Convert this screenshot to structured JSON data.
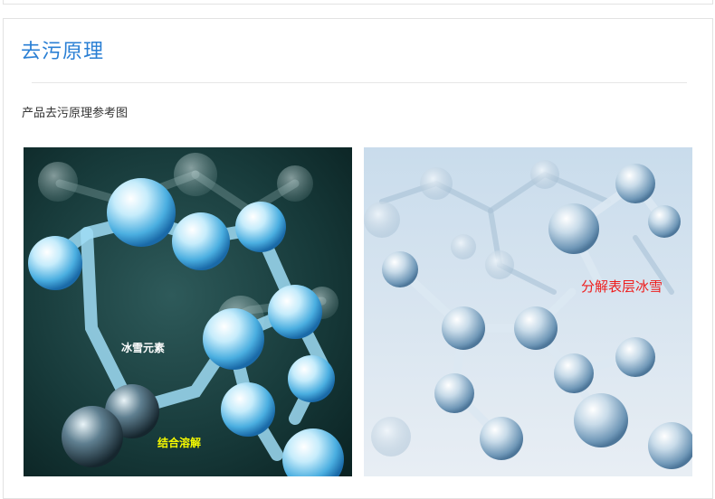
{
  "section": {
    "title": "去污原理",
    "caption": "产品去污原理参考图"
  },
  "figures": [
    {
      "labels": [
        {
          "text": "冰雪元素",
          "color": "#ffffff"
        },
        {
          "text": "结合溶解",
          "color": "#f4f800"
        }
      ]
    },
    {
      "labels": [
        {
          "text": "分解表层冰雪",
          "color": "#ee1d1d"
        }
      ]
    }
  ]
}
